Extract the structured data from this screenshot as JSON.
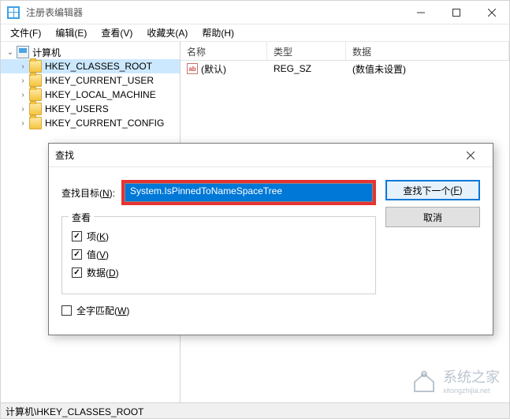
{
  "window": {
    "title": "注册表编辑器"
  },
  "menu": {
    "file": "文件(F)",
    "edit": "编辑(E)",
    "view": "查看(V)",
    "favorites": "收藏夹(A)",
    "help": "帮助(H)"
  },
  "tree": {
    "root": "计算机",
    "items": [
      "HKEY_CLASSES_ROOT",
      "HKEY_CURRENT_USER",
      "HKEY_LOCAL_MACHINE",
      "HKEY_USERS",
      "HKEY_CURRENT_CONFIG"
    ]
  },
  "list": {
    "headers": {
      "name": "名称",
      "type": "类型",
      "data": "数据"
    },
    "rows": [
      {
        "icon": "ab",
        "name": "(默认)",
        "type": "REG_SZ",
        "data": "(数值未设置)"
      }
    ]
  },
  "statusbar": "计算机\\HKEY_CLASSES_ROOT",
  "dialog": {
    "title": "查找",
    "search_label_pre": "查找目标(",
    "search_label_u": "N",
    "search_label_post": "):",
    "search_value": "System.IsPinnedToNameSpaceTree",
    "fieldset_legend": "查看",
    "opt_key_pre": "项(",
    "opt_key_u": "K",
    "opt_key_post": ")",
    "opt_value_pre": "值(",
    "opt_value_u": "V",
    "opt_value_post": ")",
    "opt_data_pre": "数据(",
    "opt_data_u": "D",
    "opt_data_post": ")",
    "opt_whole_pre": "全字匹配(",
    "opt_whole_u": "W",
    "opt_whole_post": ")",
    "btn_find_pre": "查找下一个(",
    "btn_find_u": "F",
    "btn_find_post": ")",
    "btn_cancel": "取消"
  },
  "watermark": "系统之家",
  "watermark_sub": "xitongzhijia.net"
}
